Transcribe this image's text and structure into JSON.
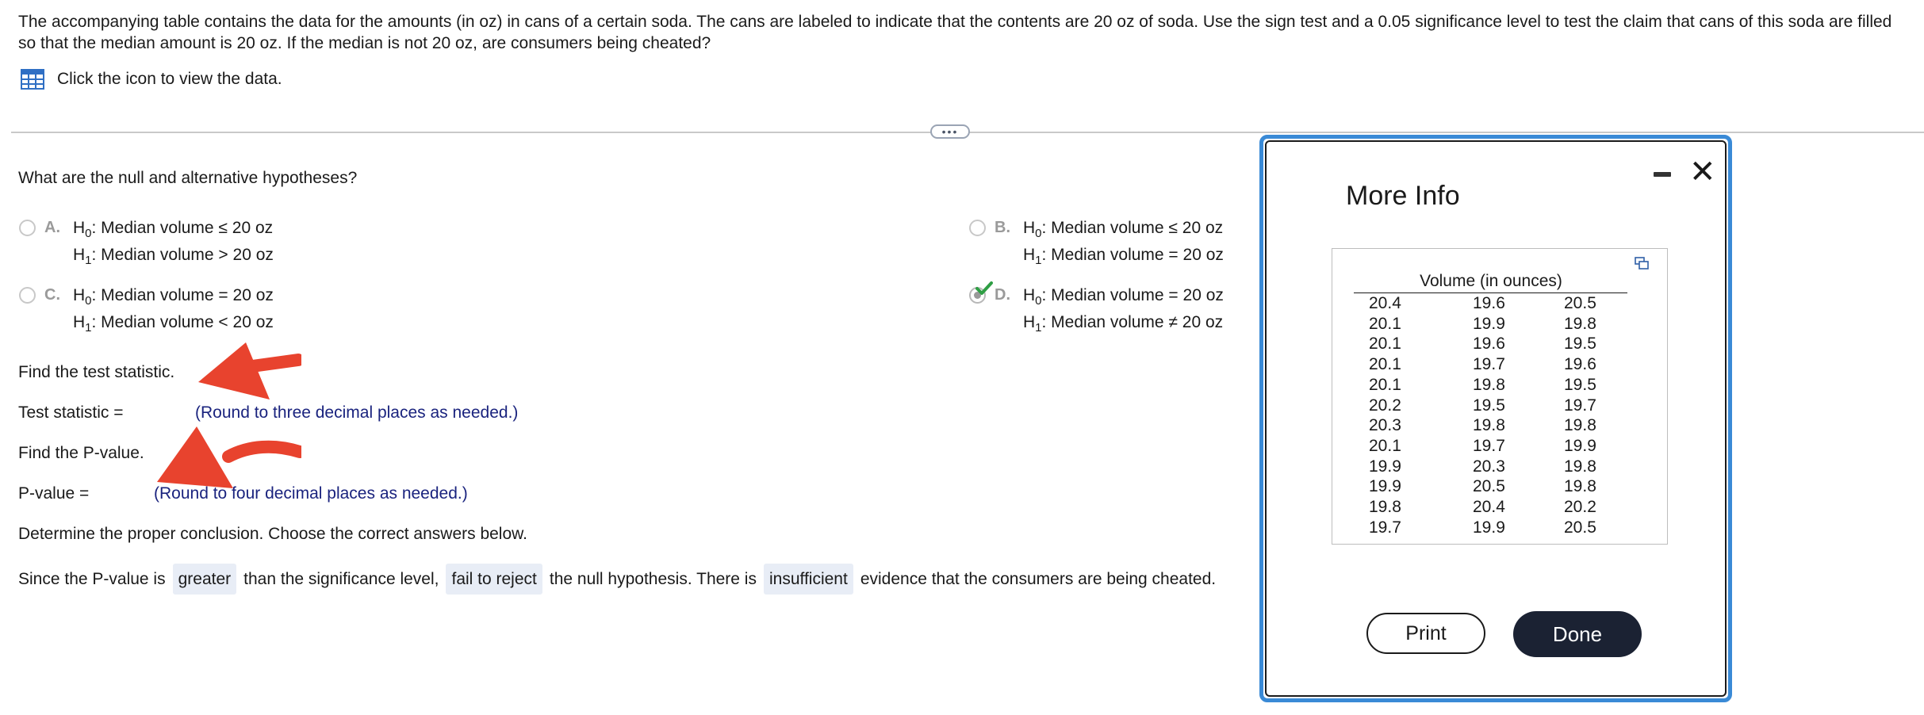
{
  "question": {
    "text": "The accompanying table contains the data for the amounts (in oz) in cans of a certain soda. The cans are labeled to indicate that the contents are 20 oz of soda. Use the sign test and a 0.05 significance level to test the claim that cans of this soda are filled so that the median amount is 20 oz. If the median is not 20 oz, are consumers being cheated?",
    "data_link": "Click the icon to view the data."
  },
  "hypotheses": {
    "prompt": "What are the null and alternative hypotheses?",
    "options": [
      {
        "letter": "A.",
        "h0": ": Median volume ≤ 20 oz",
        "h1": ": Median volume > 20 oz"
      },
      {
        "letter": "B.",
        "h0": ": Median volume ≤ 20 oz",
        "h1": ": Median volume = 20 oz"
      },
      {
        "letter": "C.",
        "h0": ": Median volume = 20 oz",
        "h1": ": Median volume < 20 oz"
      },
      {
        "letter": "D.",
        "h0": ": Median volume = 20 oz",
        "h1": ": Median volume ≠ 20 oz"
      }
    ],
    "selected": "D."
  },
  "test_stat": {
    "prompt": "Find the test statistic.",
    "label": "Test statistic =",
    "hint": "(Round to three decimal places as needed.)",
    "value": ""
  },
  "p_value": {
    "prompt": "Find the P-value.",
    "label": "P-value =",
    "hint": "(Round to four decimal places as needed.)",
    "value": ""
  },
  "conclusion": {
    "prompt": "Determine the proper conclusion. Choose the correct answers below.",
    "part1": "Since the P-value is",
    "dd1": "greater",
    "part2": "than the significance level,",
    "dd2": "fail to reject",
    "part3": "the null hypothesis. There is",
    "dd3": "insufficient",
    "part4": "evidence that the consumers are being cheated."
  },
  "modal": {
    "title": "More Info",
    "table_title": "Volume (in ounces)",
    "rows": [
      [
        "20.4",
        "19.6",
        "20.5"
      ],
      [
        "20.1",
        "19.9",
        "19.8"
      ],
      [
        "20.1",
        "19.6",
        "19.5"
      ],
      [
        "20.1",
        "19.7",
        "19.6"
      ],
      [
        "20.1",
        "19.8",
        "19.5"
      ],
      [
        "20.2",
        "19.5",
        "19.7"
      ],
      [
        "20.3",
        "19.8",
        "19.8"
      ],
      [
        "20.1",
        "19.7",
        "19.9"
      ],
      [
        "19.9",
        "20.3",
        "19.8"
      ],
      [
        "19.9",
        "20.5",
        "19.8"
      ],
      [
        "19.8",
        "20.4",
        "20.2"
      ],
      [
        "19.7",
        "19.9",
        "20.5"
      ]
    ],
    "print_label": "Print",
    "done_label": "Done"
  },
  "colors": {
    "accent_blue": "#3a8ad6",
    "annotation_arrow": "#e8432e",
    "hint_navy": "#1a237e",
    "check_green": "#2e9e44"
  }
}
